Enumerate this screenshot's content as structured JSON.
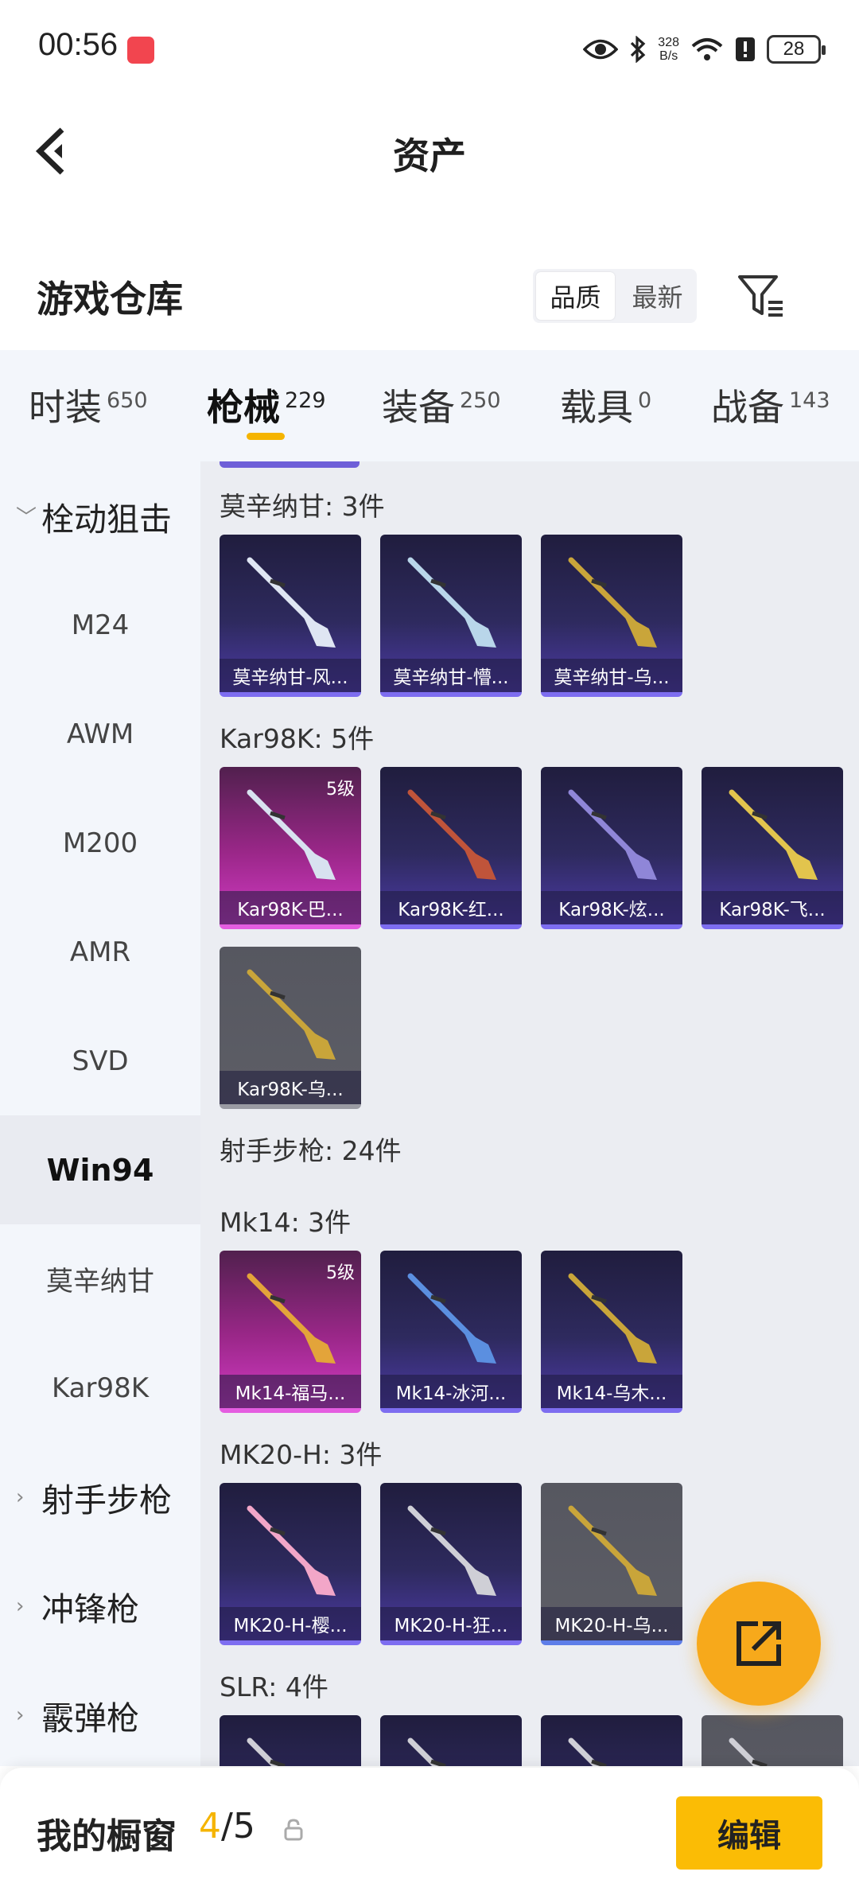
{
  "status_bar": {
    "time": "00:56",
    "net_speed_value": "328",
    "net_speed_unit": "B/s",
    "battery": "28"
  },
  "header": {
    "title": "资产"
  },
  "warehouse": {
    "title": "游戏仓库",
    "sort_options": [
      "品质",
      "最新"
    ],
    "active_sort": "品质"
  },
  "category_tabs": [
    {
      "label": "时装",
      "count": "650"
    },
    {
      "label": "枪械",
      "count": "229",
      "active": true
    },
    {
      "label": "装备",
      "count": "250"
    },
    {
      "label": "载具",
      "count": "0"
    },
    {
      "label": "战备",
      "count": "143"
    }
  ],
  "sidebar": {
    "items": [
      {
        "label": "栓动狙击",
        "type": "group",
        "expanded": true
      },
      {
        "label": "M24",
        "type": "child"
      },
      {
        "label": "AWM",
        "type": "child"
      },
      {
        "label": "M200",
        "type": "child"
      },
      {
        "label": "AMR",
        "type": "child"
      },
      {
        "label": "SVD",
        "type": "child"
      },
      {
        "label": "Win94",
        "type": "child",
        "selected": true
      },
      {
        "label": "莫辛纳甘",
        "type": "child"
      },
      {
        "label": "Kar98K",
        "type": "child"
      },
      {
        "label": "射手步枪",
        "type": "group",
        "expanded": false
      },
      {
        "label": "冲锋枪",
        "type": "group",
        "expanded": false
      },
      {
        "label": "霰弹枪",
        "type": "group",
        "expanded": false
      }
    ]
  },
  "sections": [
    {
      "label": "莫辛纳甘: 3件",
      "items": [
        {
          "name": "莫辛纳甘-风...",
          "rarity": "purple",
          "gun_color": "#dfe6f3"
        },
        {
          "name": "莫辛纳甘-懵...",
          "rarity": "purple",
          "gun_color": "#b9d6ea"
        },
        {
          "name": "莫辛纳甘-乌...",
          "rarity": "purple",
          "gun_color": "#c9a53a"
        }
      ]
    },
    {
      "label": "Kar98K: 5件",
      "items": [
        {
          "name": "Kar98K-巴...",
          "rarity": "pink",
          "level": "5级",
          "gun_color": "#d8e2f0"
        },
        {
          "name": "Kar98K-红...",
          "rarity": "purple",
          "gun_color": "#c0543a"
        },
        {
          "name": "Kar98K-炫...",
          "rarity": "purple",
          "gun_color": "#8f86d8"
        },
        {
          "name": "Kar98K-飞...",
          "rarity": "purple",
          "gun_color": "#e2c44d"
        },
        {
          "name": "Kar98K-乌...",
          "rarity": "grey",
          "gun_color": "#c9a53a"
        }
      ]
    },
    {
      "label": "射手步枪: 24件",
      "items": []
    },
    {
      "label": "Mk14: 3件",
      "items": [
        {
          "name": "Mk14-福马...",
          "rarity": "pink",
          "level": "5级",
          "gun_color": "#e3a43a"
        },
        {
          "name": "Mk14-冰河...",
          "rarity": "purple",
          "gun_color": "#5b8fe0"
        },
        {
          "name": "Mk14-乌木...",
          "rarity": "purple",
          "gun_color": "#c9a53a"
        }
      ]
    },
    {
      "label": "MK20-H: 3件",
      "items": [
        {
          "name": "MK20-H-樱...",
          "rarity": "purple",
          "gun_color": "#f2a6c8"
        },
        {
          "name": "MK20-H-狂...",
          "rarity": "purple",
          "gun_color": "#cfcfd6"
        },
        {
          "name": "MK20-H-乌...",
          "rarity": "grey",
          "gun_color": "#c9a53a"
        }
      ]
    },
    {
      "label": "SLR: 4件",
      "items": [
        {
          "name": "",
          "rarity": "purple",
          "gun_color": "#cfcfd6"
        },
        {
          "name": "",
          "rarity": "purple",
          "gun_color": "#cfcfd6"
        },
        {
          "name": "",
          "rarity": "purple",
          "gun_color": "#cfcfd6"
        },
        {
          "name": "",
          "rarity": "grey",
          "gun_color": "#cfcfd6"
        }
      ]
    }
  ],
  "bottom_bar": {
    "title": "我的橱窗",
    "current": "4",
    "separator": "/",
    "total": "5",
    "edit_label": "编辑"
  },
  "colors": {
    "accent": "#f5b400",
    "fab": "#f7a91b",
    "purple_rarity": "#7d6df0",
    "pink_rarity": "#d13bc4"
  },
  "icons": [
    "back-arrow-icon",
    "filter-icon",
    "eye-icon",
    "bluetooth-icon",
    "wifi-icon",
    "alert-icon",
    "share-export-icon",
    "lock-icon"
  ]
}
